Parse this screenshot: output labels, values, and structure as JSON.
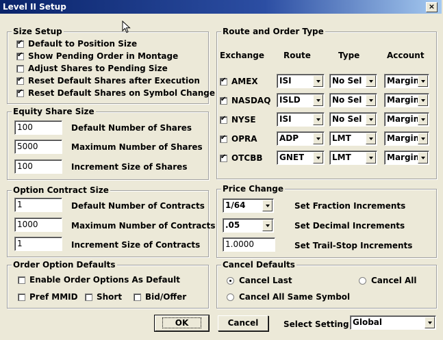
{
  "window": {
    "title": "Level II Setup",
    "close": "×"
  },
  "size_setup": {
    "label": "Size Setup",
    "items": [
      {
        "label": "Default to Position Size",
        "checked": true
      },
      {
        "label": "Show Pending Order in Montage",
        "checked": true
      },
      {
        "label": "Adjust Shares to Pending Size",
        "checked": false
      },
      {
        "label": "Reset Default Shares after Execution",
        "checked": true
      },
      {
        "label": "Reset Default Shares on Symbol Change",
        "checked": true
      }
    ]
  },
  "equity": {
    "label": "Equity Share Size",
    "rows": [
      {
        "value": "100",
        "label": "Default Number of Shares"
      },
      {
        "value": "5000",
        "label": "Maximum Number of Shares"
      },
      {
        "value": "100",
        "label": "Increment Size of Shares"
      }
    ]
  },
  "option": {
    "label": "Option Contract Size",
    "rows": [
      {
        "value": "1",
        "label": "Default Number of Contracts"
      },
      {
        "value": "1000",
        "label": "Maximum Number of Contracts"
      },
      {
        "value": "1",
        "label": "Increment Size of Contracts"
      }
    ]
  },
  "order_defaults": {
    "label": "Order Option Defaults",
    "enable": {
      "label": "Enable Order Options As Default",
      "checked": false
    },
    "pref": {
      "label": "Pref MMID",
      "checked": false
    },
    "short": {
      "label": "Short",
      "checked": false
    },
    "bid": {
      "label": "Bid/Offer",
      "checked": false
    }
  },
  "route": {
    "label": "Route and Order Type",
    "headers": {
      "exchange": "Exchange",
      "route": "Route",
      "type": "Type",
      "account": "Account"
    },
    "rows": [
      {
        "exchange": "AMEX",
        "checked": true,
        "route": "ISI",
        "type": "No Sel",
        "account": "Margin"
      },
      {
        "exchange": "NASDAQ",
        "checked": true,
        "route": "ISLD",
        "type": "No Sel",
        "account": "Margin"
      },
      {
        "exchange": "NYSE",
        "checked": true,
        "route": "ISI",
        "type": "No Sel",
        "account": "Margin"
      },
      {
        "exchange": "OPRA",
        "checked": true,
        "route": "ADP",
        "type": "LMT",
        "account": "Margin"
      },
      {
        "exchange": "OTCBB",
        "checked": true,
        "route": "GNET",
        "type": "LMT",
        "account": "Margin"
      }
    ]
  },
  "price": {
    "label": "Price Change",
    "fraction": {
      "value": "1/64",
      "label": "Set Fraction Increments"
    },
    "decimal": {
      "value": ".05",
      "label": "Set Decimal Increments"
    },
    "trail": {
      "value": "1.0000",
      "label": "Set Trail-Stop Increments"
    }
  },
  "cancel": {
    "label": "Cancel Defaults",
    "last": {
      "label": "Cancel Last",
      "checked": true
    },
    "all": {
      "label": "Cancel All",
      "checked": false
    },
    "same": {
      "label": "Cancel All Same Symbol",
      "checked": false
    }
  },
  "footer": {
    "ok": "OK",
    "cancel": "Cancel",
    "select_label": "Select Setting",
    "select_value": "Global"
  }
}
